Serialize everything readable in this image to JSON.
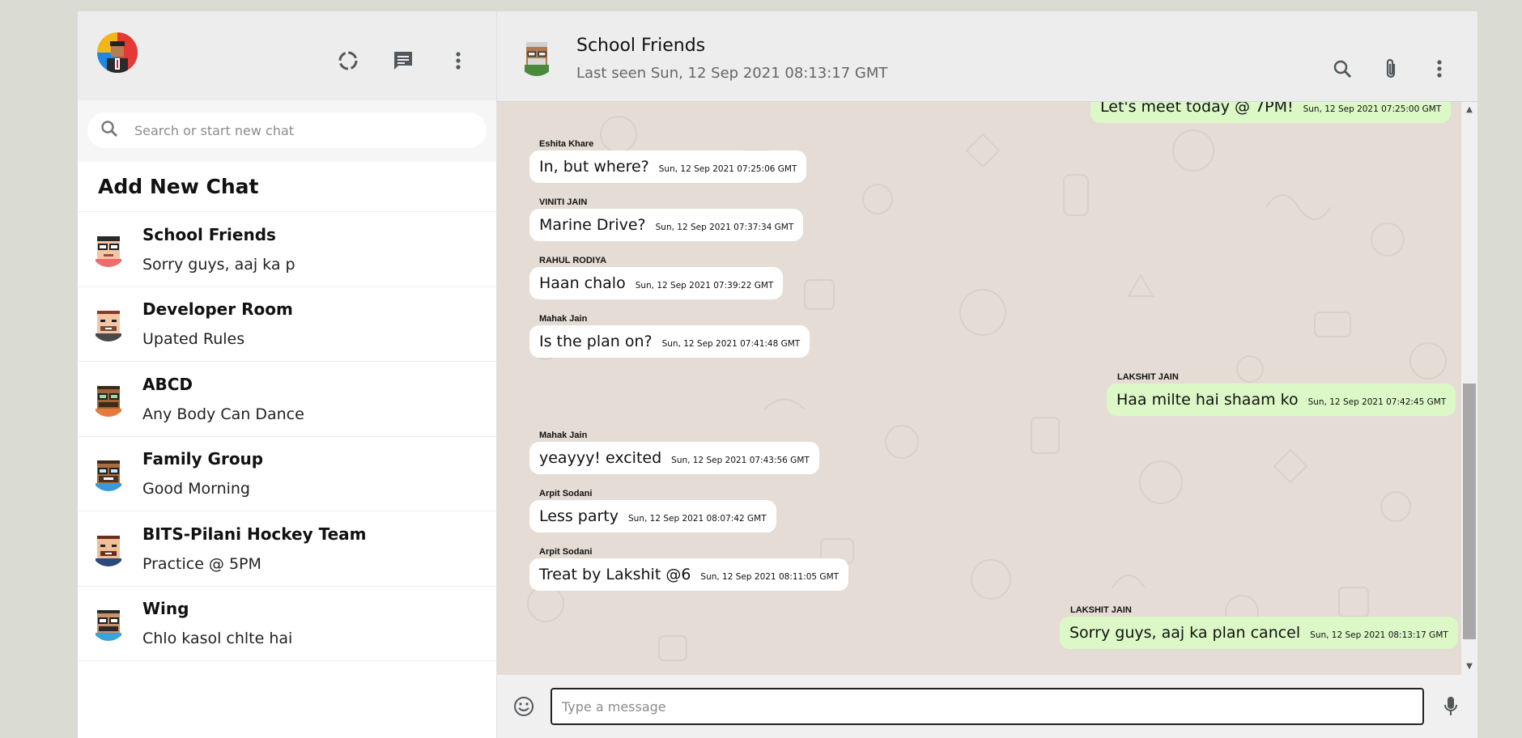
{
  "sidebar": {
    "search_placeholder": "Search or start new chat",
    "add_new_chat": "Add New Chat",
    "chats": [
      {
        "name": "School Friends",
        "last": "Sorry guys, aaj ka p"
      },
      {
        "name": "Developer Room",
        "last": "Upated Rules"
      },
      {
        "name": "ABCD",
        "last": "Any Body Can Dance"
      },
      {
        "name": "Family Group",
        "last": "Good Morning"
      },
      {
        "name": "BITS-Pilani Hockey Team",
        "last": "Practice @ 5PM"
      },
      {
        "name": "Wing",
        "last": "Chlo kasol chlte hai"
      }
    ]
  },
  "chat": {
    "title": "School Friends",
    "subtitle": "Last seen Sun, 12 Sep 2021 08:13:17 GMT",
    "composer_placeholder": "Type a message",
    "messages": [
      {
        "dir": "out",
        "sender": "",
        "text": "Let's meet today @ 7PM!",
        "time": "Sun, 12 Sep 2021 07:25:00 GMT"
      },
      {
        "dir": "in",
        "sender": "Eshita Khare",
        "text": "In, but where?",
        "time": "Sun, 12 Sep 2021 07:25:06 GMT"
      },
      {
        "dir": "in",
        "sender": "VINITI JAIN",
        "text": "Marine Drive?",
        "time": "Sun, 12 Sep 2021 07:37:34 GMT"
      },
      {
        "dir": "in",
        "sender": "RAHUL RODIYA",
        "text": "Haan chalo",
        "time": "Sun, 12 Sep 2021 07:39:22 GMT"
      },
      {
        "dir": "in",
        "sender": "Mahak Jain",
        "text": "Is the plan on?",
        "time": "Sun, 12 Sep 2021 07:41:48 GMT"
      },
      {
        "dir": "out",
        "sender": "LAKSHIT JAIN",
        "text": "Haa milte hai shaam ko",
        "time": "Sun, 12 Sep 2021 07:42:45 GMT"
      },
      {
        "dir": "in",
        "sender": "Mahak Jain",
        "text": "yeayyy! excited",
        "time": "Sun, 12 Sep 2021 07:43:56 GMT"
      },
      {
        "dir": "in",
        "sender": "Arpit Sodani",
        "text": "Less party",
        "time": "Sun, 12 Sep 2021 08:07:42 GMT"
      },
      {
        "dir": "in",
        "sender": "Arpit Sodani",
        "text": "Treat by Lakshit @6",
        "time": "Sun, 12 Sep 2021 08:11:05 GMT"
      },
      {
        "dir": "out",
        "sender": "LAKSHIT JAIN",
        "text": "Sorry guys, aaj ka plan cancel",
        "time": "Sun, 12 Sep 2021 08:13:17 GMT"
      }
    ]
  },
  "icons": {
    "status": "status-ring-icon",
    "new_chat": "chat-bubble-icon",
    "menu": "vertical-dots-icon",
    "search": "search-icon",
    "attach": "paperclip-icon",
    "emoji": "emoji-icon",
    "mic": "microphone-icon"
  },
  "colors": {
    "outgoing_bubble": "#dcf8c6",
    "incoming_bubble": "#ffffff",
    "chat_background": "#e5ddd5",
    "header_background": "#ededed"
  }
}
